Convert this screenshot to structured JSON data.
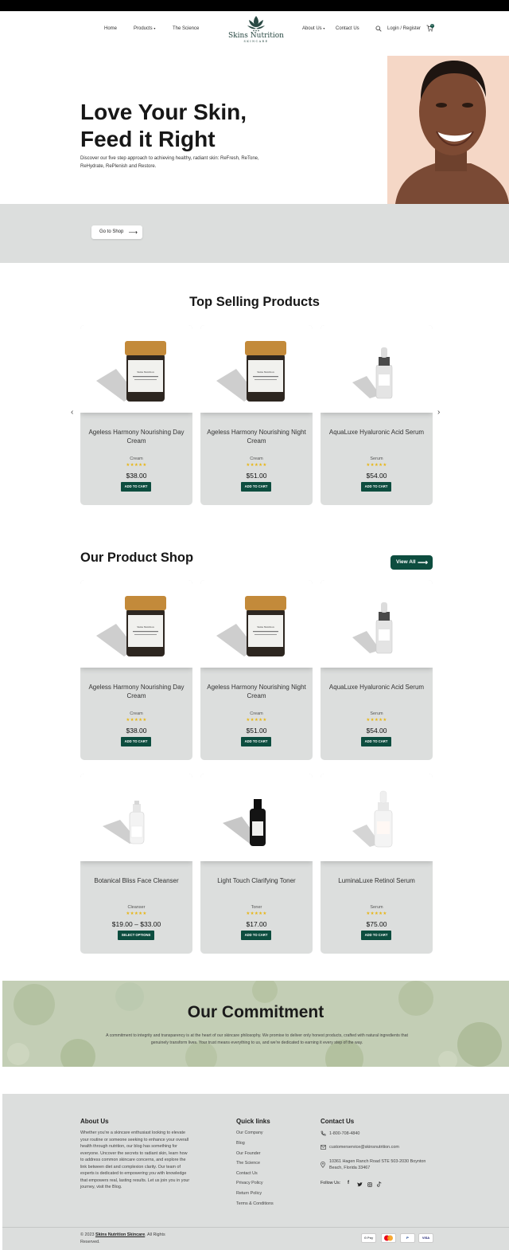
{
  "header": {
    "nav_left": [
      "Home",
      "Products",
      "The Science"
    ],
    "nav_right": [
      "About Us",
      "Contact Us"
    ],
    "logo_text": "Skins Nutrition",
    "logo_sub": "SKINCARE",
    "login_label": "Login / Register",
    "cart_count": "0"
  },
  "hero": {
    "title_line1": "Love Your Skin,",
    "title_line2": "Feed it Right",
    "description": "Discover our five step approach to achieving healthy, radiant skin: ReFresh, ReTone, ReHydrate, RePlenish and Restore.",
    "cta_label": "Go to Shop"
  },
  "top_selling": {
    "title": "Top Selling Products",
    "products": [
      {
        "name": "Ageless Harmony Nourishing Day Cream",
        "category": "Cream",
        "price": "$38.00",
        "button": "ADD TO CART"
      },
      {
        "name": "Ageless Harmony Nourishing Night Cream",
        "category": "Cream",
        "price": "$51.00",
        "button": "ADD TO CART"
      },
      {
        "name": "AquaLuxe Hyaluronic Acid Serum",
        "category": "Serum",
        "price": "$54.00",
        "button": "ADD TO CART"
      }
    ]
  },
  "shop": {
    "title": "Our Product Shop",
    "view_all": "View All",
    "products": [
      {
        "name": "Ageless Harmony Nourishing Day Cream",
        "category": "Cream",
        "price": "$38.00",
        "button": "ADD TO CART"
      },
      {
        "name": "Ageless Harmony Nourishing Night Cream",
        "category": "Cream",
        "price": "$51.00",
        "button": "ADD TO CART"
      },
      {
        "name": "AquaLuxe Hyaluronic Acid Serum",
        "category": "Serum",
        "price": "$54.00",
        "button": "ADD TO CART"
      },
      {
        "name": "Botanical Bliss Face Cleanser",
        "category": "Cleanser",
        "price": "$19.00 – $33.00",
        "button": "SELECT OPTIONS"
      },
      {
        "name": "Light Touch Clarifying Toner",
        "category": "Toner",
        "price": "$17.00",
        "button": "ADD TO CART"
      },
      {
        "name": "LuminaLuxe Retinol Serum",
        "category": "Serum",
        "price": "$75.00",
        "button": "ADD TO CART"
      }
    ]
  },
  "rating_stars": "★★★★★",
  "commitment": {
    "title": "Our Commitment",
    "text": "A commitment to integrity and transparency is at the heart of our skincare philosophy. We promise to deliver only honest products, crafted with natural ingredients that genuinely transform lives. Your trust means everything to us, and we're dedicated to earning it every step of the way."
  },
  "footer": {
    "about_title": "About Us",
    "about_text": "Whether you're a skincare enthusiast looking to elevate your routine or someone seeking to enhance your overall health through nutrition, our blog has something for everyone. Uncover the secrets to radiant skin, learn how to address common skincare concerns, and explore the link between diet and complexion clarity. Our team of experts is dedicated to empowering you with knowledge that empowers real, lasting results. Let us join you in your journey, visit the Blog.",
    "links_title": "Quick links",
    "links": [
      "Our Company",
      "Blog",
      "Our Founder",
      "The Science",
      "Contact Us",
      "Privacy Policy",
      "Return Policy",
      "Terms & Conditions"
    ],
    "contact_title": "Contact Us",
    "phone": "1-800-708-4840",
    "email": "customerservice@skinsnutrition.com",
    "address": "10361 Hagen Ranch Road STE 503-2030 Boynton Beach, Florida 33467",
    "follow_label": "Follow Us:",
    "copyright_prefix": "© 2023",
    "copyright_brand": "Skins Nutrition Skincare",
    "copyright_suffix": ". All Rights Reserved.",
    "payments": [
      "G Pay",
      "MC",
      "P",
      "VISA"
    ]
  },
  "colors": {
    "brand_green": "#0d4d3f",
    "card_gray": "#dcdedd",
    "star_gold": "#e8b616"
  }
}
